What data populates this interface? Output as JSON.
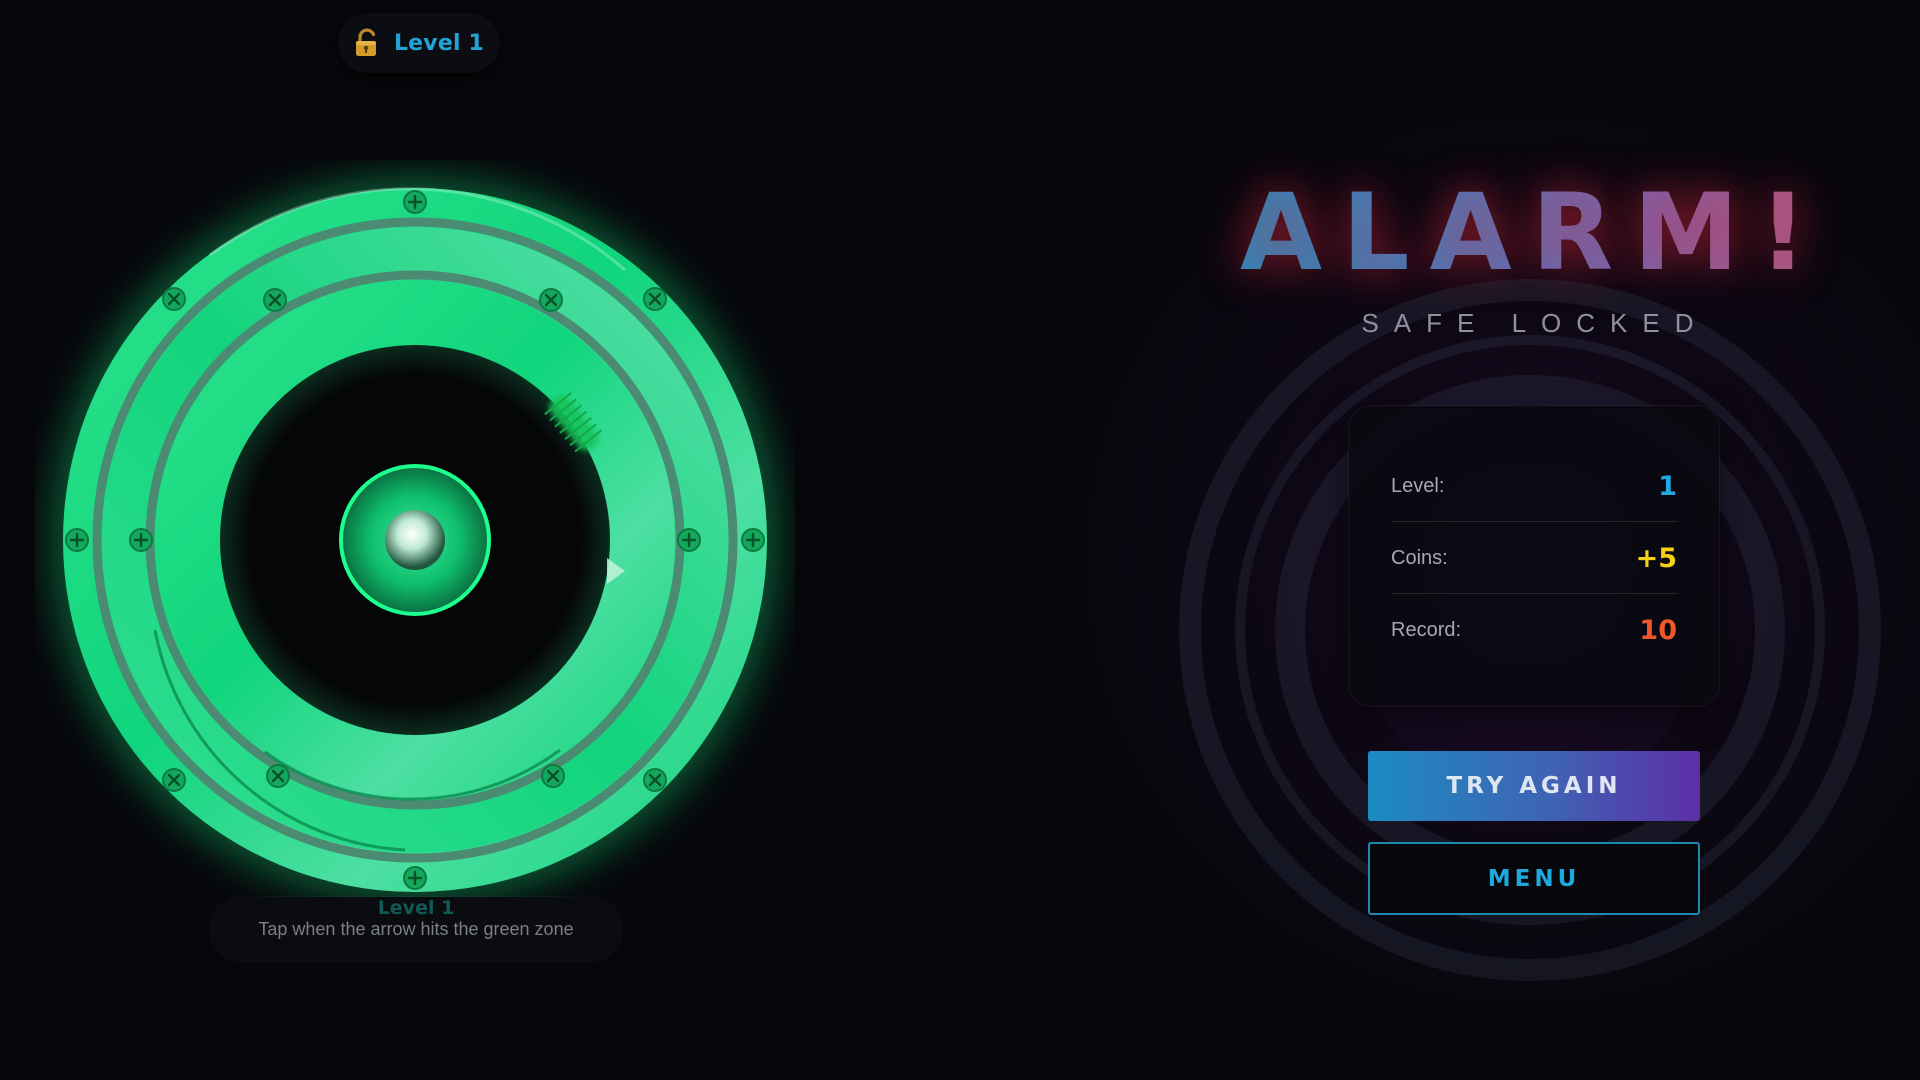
{
  "hud": {
    "level_badge": "Level 1",
    "level_icon": "unlocked-padlock-icon"
  },
  "dial": {
    "arrow_icon": "pointer-arrow-icon",
    "target_zone_color": "#19c45a",
    "glow_color": "#14e08a"
  },
  "hint": {
    "level_label": "Level 1",
    "instruction": "Tap when the arrow hits the green zone"
  },
  "result": {
    "title": "ALARM!",
    "subtitle": "SAFE LOCKED",
    "stats": [
      {
        "label": "Level:",
        "value": "1",
        "color": "#23a9e1"
      },
      {
        "label": "Coins:",
        "value": "+5",
        "color": "#f5d215"
      },
      {
        "label": "Record:",
        "value": "10",
        "color": "#f0582c"
      }
    ],
    "try_again_label": "TRY AGAIN",
    "menu_label": "MENU"
  },
  "colors": {
    "background": "#07070b",
    "accent_blue": "#1ea9dd",
    "accent_purple": "#5d2ea6"
  }
}
